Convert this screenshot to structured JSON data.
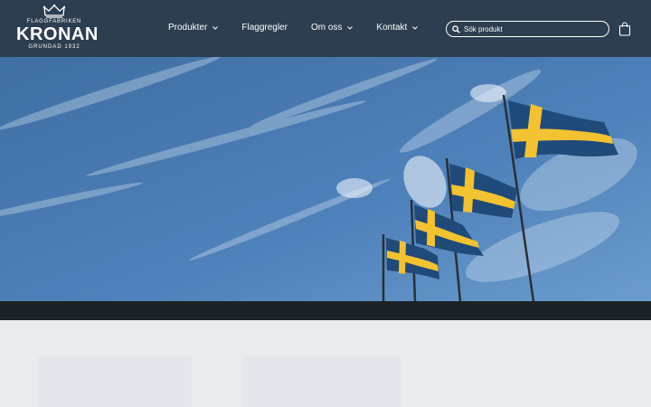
{
  "header": {
    "logo": {
      "top_text": "FLAGGFABRIKEN",
      "brand": "KRONAN",
      "established": "GRUNDAD 1932",
      "icon": "crown-icon"
    },
    "nav": [
      {
        "label": "Produkter",
        "has_dropdown": true
      },
      {
        "label": "Flaggregler",
        "has_dropdown": false
      },
      {
        "label": "Om oss",
        "has_dropdown": true
      },
      {
        "label": "Kontakt",
        "has_dropdown": true
      }
    ],
    "search": {
      "placeholder": "Sök produkt",
      "icon": "search-icon"
    },
    "cart": {
      "icon": "shopping-bag-icon"
    }
  },
  "hero": {
    "image": "swedish-flags-on-poles-against-blue-sky"
  },
  "colors": {
    "header_bg": "#2c3e50",
    "dark_band": "#1c2326",
    "page_bg": "#e9ecef",
    "flag_blue": "#1f4a7a",
    "flag_yellow": "#f2c230"
  }
}
